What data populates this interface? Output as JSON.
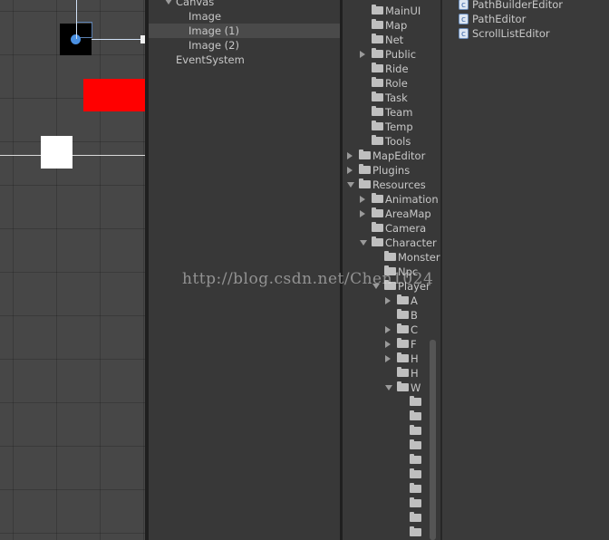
{
  "hierarchy": {
    "items": [
      {
        "label": "Canvas",
        "indent": 1,
        "expanded": true
      },
      {
        "label": "Image",
        "indent": 2
      },
      {
        "label": "Image (1)",
        "indent": 2,
        "selected": true
      },
      {
        "label": "Image (2)",
        "indent": 2
      },
      {
        "label": "EventSystem",
        "indent": 1
      }
    ]
  },
  "project": {
    "items": [
      {
        "label": "MainUI",
        "indent": 2
      },
      {
        "label": "Map",
        "indent": 2
      },
      {
        "label": "Net",
        "indent": 2
      },
      {
        "label": "Public",
        "indent": 2,
        "arrow": "right"
      },
      {
        "label": "Ride",
        "indent": 2
      },
      {
        "label": "Role",
        "indent": 2
      },
      {
        "label": "Task",
        "indent": 2
      },
      {
        "label": "Team",
        "indent": 2
      },
      {
        "label": "Temp",
        "indent": 2
      },
      {
        "label": "Tools",
        "indent": 2
      },
      {
        "label": "MapEditor",
        "indent": 1,
        "arrow": "right"
      },
      {
        "label": "Plugins",
        "indent": 1,
        "arrow": "right"
      },
      {
        "label": "Resources",
        "indent": 1,
        "arrow": "down"
      },
      {
        "label": "Animation",
        "indent": 2,
        "arrow": "right"
      },
      {
        "label": "AreaMap",
        "indent": 2,
        "arrow": "right"
      },
      {
        "label": "Camera",
        "indent": 2
      },
      {
        "label": "Character",
        "indent": 2,
        "arrow": "down"
      },
      {
        "label": "Monster",
        "indent": 3
      },
      {
        "label": "Npc",
        "indent": 3
      },
      {
        "label": "Player",
        "indent": 3,
        "arrow": "down"
      },
      {
        "label": "A",
        "indent": 4,
        "arrow": "right"
      },
      {
        "label": "B",
        "indent": 4
      },
      {
        "label": "C",
        "indent": 4,
        "arrow": "right"
      },
      {
        "label": "F",
        "indent": 4,
        "arrow": "right"
      },
      {
        "label": "H",
        "indent": 4,
        "arrow": "right"
      },
      {
        "label": "H",
        "indent": 4
      },
      {
        "label": "W",
        "indent": 4,
        "arrow": "down"
      },
      {
        "label": "",
        "indent": 5
      },
      {
        "label": "",
        "indent": 5
      },
      {
        "label": "",
        "indent": 5
      },
      {
        "label": "",
        "indent": 5
      },
      {
        "label": "",
        "indent": 5
      },
      {
        "label": "",
        "indent": 5
      },
      {
        "label": "",
        "indent": 5
      },
      {
        "label": "",
        "indent": 5
      },
      {
        "label": "",
        "indent": 5
      },
      {
        "label": "",
        "indent": 5
      }
    ]
  },
  "assets": {
    "items": [
      {
        "label": "PathBuilderEditor",
        "icon": "csharp-script-icon"
      },
      {
        "label": "PathEditor",
        "icon": "csharp-script-icon"
      },
      {
        "label": "ScrollListEditor",
        "icon": "csharp-script-icon"
      }
    ]
  },
  "watermark": "http://blog.csdn.net/Chen1024",
  "colors": {
    "scene_bg": "#474747",
    "panel_bg": "#383838",
    "selection": "#4a4a4a",
    "red_image": "#ff0000",
    "white_image": "#ffffff",
    "handle_blue": "#4a90e2"
  }
}
